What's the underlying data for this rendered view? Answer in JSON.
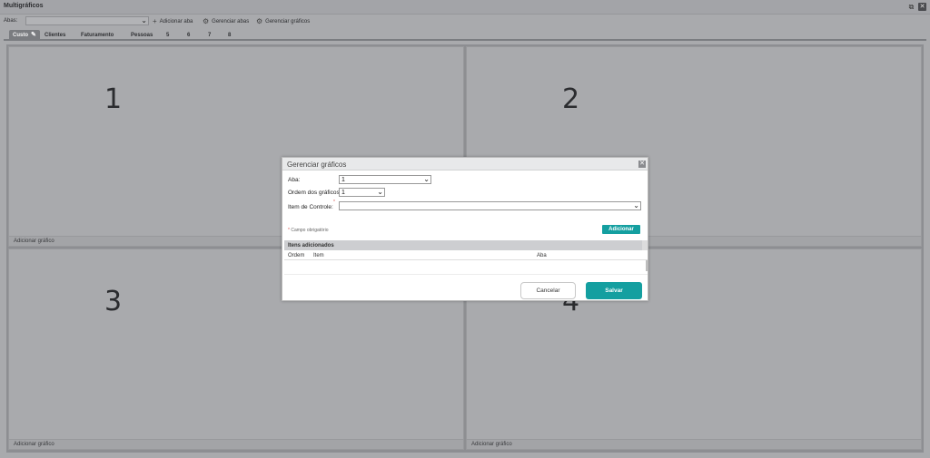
{
  "window": {
    "title": "Multigráficos"
  },
  "toolbar": {
    "abas_label": "Abas:",
    "add_tab_label": "Adicionar aba",
    "manage_tabs_label": "Gerenciar abas",
    "manage_charts_label": "Gerenciar gráficos"
  },
  "tabs": [
    {
      "label": "Custo"
    },
    {
      "label": "Clientes"
    },
    {
      "label": "Faturamento"
    },
    {
      "label": "Pessoas"
    },
    {
      "label": "5"
    },
    {
      "label": "6"
    },
    {
      "label": "7"
    },
    {
      "label": "8"
    }
  ],
  "panels": [
    {
      "number": "1",
      "footer": "Adicionar gráfico"
    },
    {
      "number": "2",
      "footer": "Adicionar gráfico"
    },
    {
      "number": "3",
      "footer": "Adicionar gráfico"
    },
    {
      "number": "4",
      "footer": "Adicionar gráfico"
    }
  ],
  "modal": {
    "title": "Gerenciar gráficos",
    "aba_label": "Aba:",
    "aba_value": "1",
    "ordem_label": "Ordem dos gráficos",
    "ordem_value": "1",
    "item_label": "Item de Controle:",
    "item_value": "",
    "required_star": "*",
    "required_note": "Campo obrigatório",
    "add_button": "Adicionar",
    "items_header": "Itens adicionados",
    "columns": {
      "ordem": "Ordem",
      "item": "Item",
      "aba": "Aba"
    },
    "cancel_button": "Cancelar",
    "save_button": "Salvar"
  },
  "colors": {
    "accent": "#149fa0",
    "overlay": "#a9aaad"
  }
}
